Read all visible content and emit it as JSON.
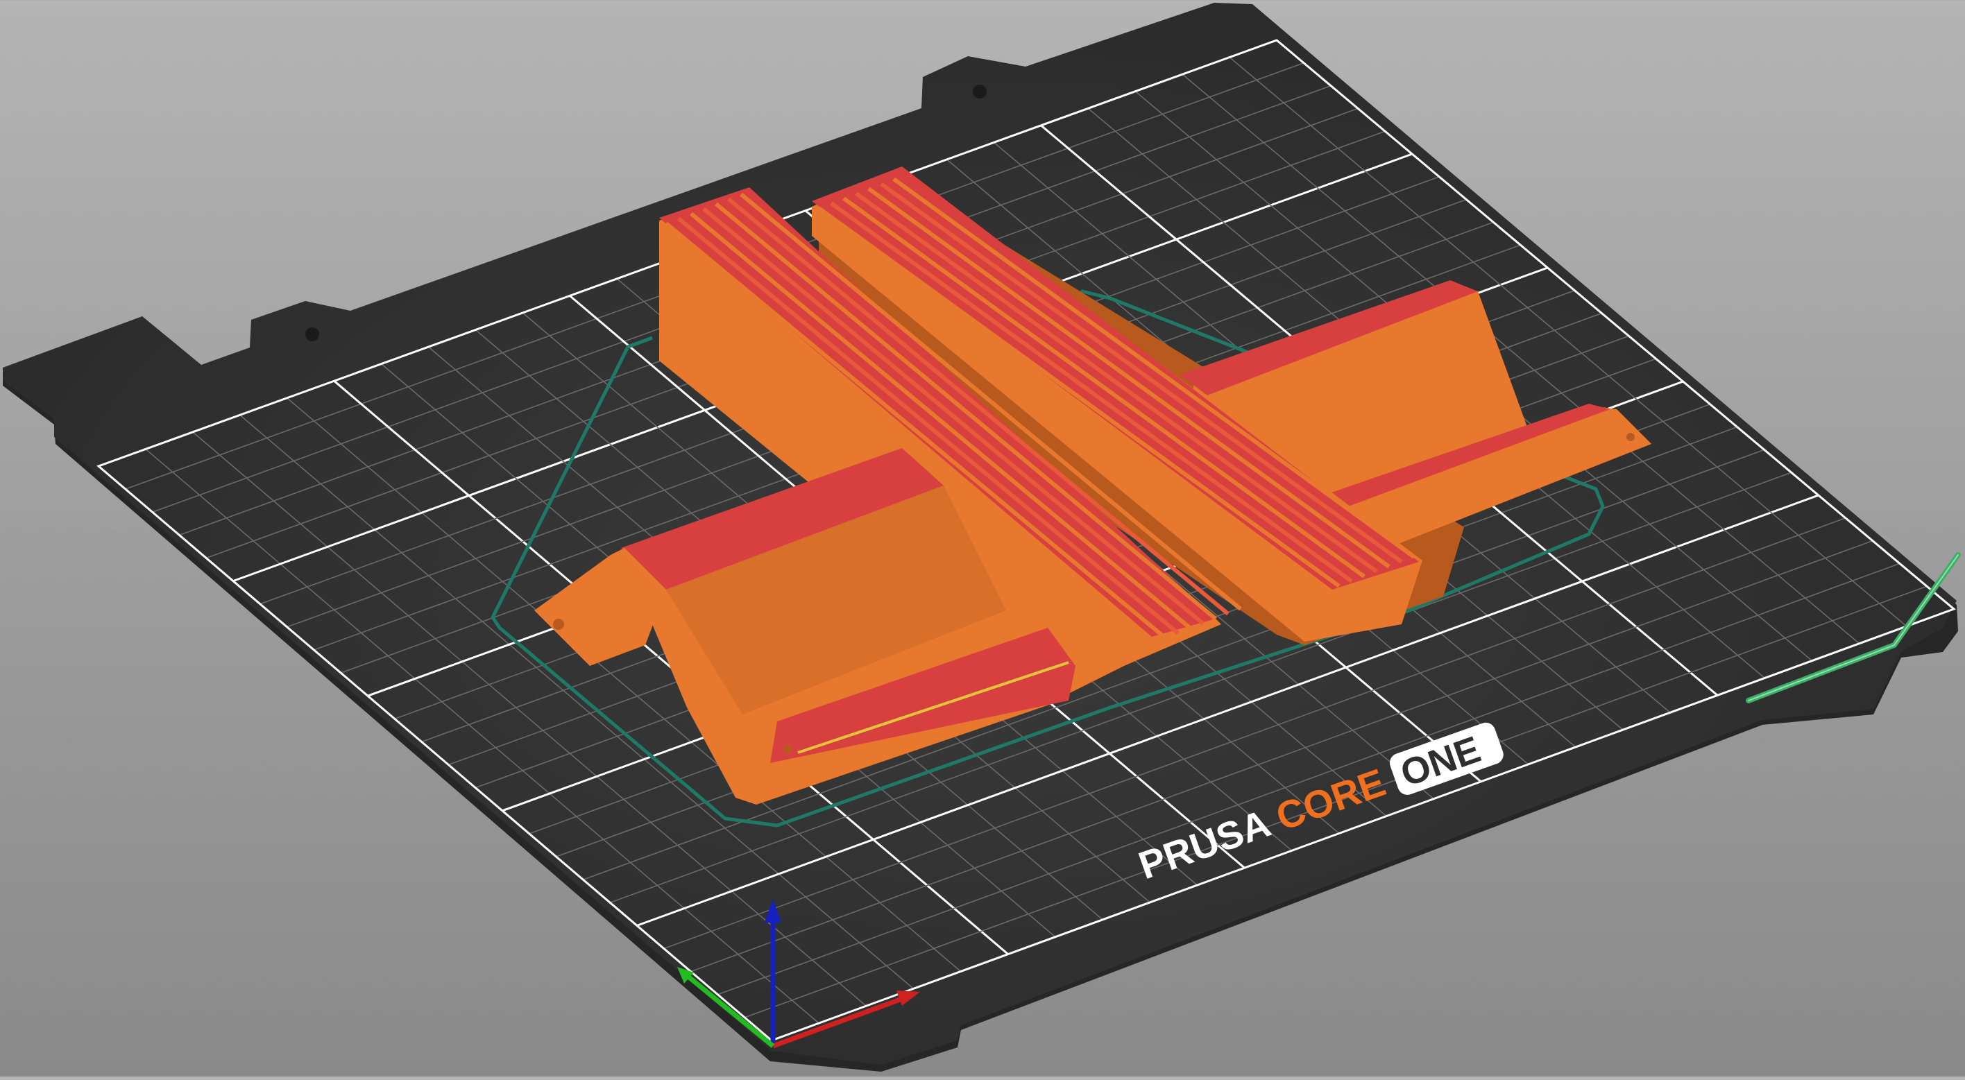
{
  "bed": {
    "brand_prusa": "PRUSA",
    "brand_core": "CORE",
    "brand_one": "ONE",
    "colors": {
      "sheet": "#2f2f2f",
      "sheet_edge": "#222222",
      "grid_minor": "#6a6a6a",
      "grid_major": "#ffffff",
      "brand_white": "#ffffff",
      "brand_orange": "#f07020"
    }
  },
  "model": {
    "colors": {
      "body": "#e8782e",
      "top_surface": "#d84040",
      "ribs": "#e85a3a",
      "shadow": "#b85a1e"
    }
  },
  "toolpath": {
    "color": "#1e7a66"
  },
  "axes": {
    "x_color": "#d02020",
    "y_color": "#22bb22",
    "z_color": "#1520c0"
  },
  "wipe_tower_marker": {
    "color": "#3fae6a"
  }
}
